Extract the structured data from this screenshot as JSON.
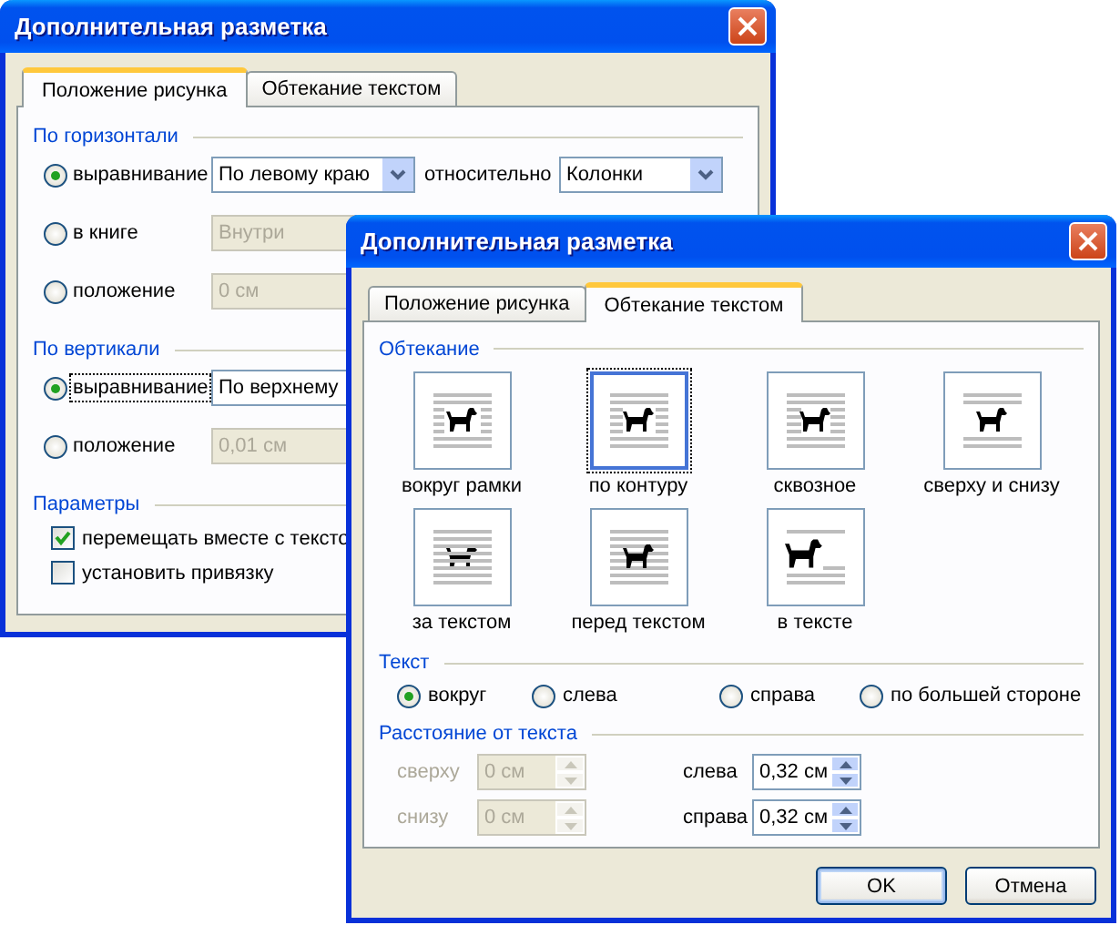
{
  "back_window": {
    "title": "Дополнительная разметка",
    "tabs": [
      {
        "label": "Положение рисунка",
        "selected": true
      },
      {
        "label": "Обтекание текстом",
        "selected": false
      }
    ],
    "sections": [
      {
        "title": "По горизонтали",
        "rows": [
          {
            "label": "выравнивание",
            "selected": true,
            "focused": false,
            "field": {
              "kind": "dropdown",
              "value": "По левому краю",
              "disabled": false
            },
            "relative_label": "относительно",
            "relative_field": {
              "kind": "dropdown",
              "value": "Колонки",
              "disabled": false
            }
          },
          {
            "label": "в книге",
            "selected": false,
            "focused": false,
            "field": {
              "kind": "dropdown",
              "value": "Внутри",
              "disabled": true
            }
          },
          {
            "label": "положение",
            "selected": false,
            "focused": false,
            "field": {
              "kind": "text",
              "value": "0 см",
              "disabled": true
            }
          }
        ]
      },
      {
        "title": "По вертикали",
        "rows": [
          {
            "label": "выравнивание",
            "selected": true,
            "focused": true,
            "field": {
              "kind": "dropdown",
              "value": "По верхнему",
              "disabled": false
            }
          },
          {
            "label": "положение",
            "selected": false,
            "focused": false,
            "field": {
              "kind": "text",
              "value": "0,01 см",
              "disabled": true
            }
          }
        ]
      }
    ],
    "options_title": "Параметры",
    "options": [
      {
        "label": "перемещать вместе с тексто",
        "checked": true
      },
      {
        "label": "установить привязку",
        "checked": false
      }
    ]
  },
  "front_window": {
    "title": "Дополнительная разметка",
    "tabs": [
      {
        "label": "Положение рисунка",
        "selected": false
      },
      {
        "label": "Обтекание текстом",
        "selected": true
      }
    ],
    "wrapping": {
      "title": "Обтекание",
      "items": [
        {
          "kind": "square",
          "label": "вокруг рамки",
          "selected": false
        },
        {
          "kind": "tight",
          "label": "по контуру",
          "selected": true
        },
        {
          "kind": "through",
          "label": "сквозное",
          "selected": false
        },
        {
          "kind": "top_bottom",
          "label": "сверху и снизу",
          "selected": false
        },
        {
          "kind": "behind",
          "label": "за текстом",
          "selected": false
        },
        {
          "kind": "in_front",
          "label": "перед текстом",
          "selected": false
        },
        {
          "kind": "inline",
          "label": "в тексте",
          "selected": false
        }
      ]
    },
    "text": {
      "title": "Текст",
      "options": [
        {
          "label": "вокруг",
          "selected": true
        },
        {
          "label": "слева",
          "selected": false
        },
        {
          "label": "справа",
          "selected": false
        },
        {
          "label": "по большей стороне",
          "selected": false
        }
      ]
    },
    "distance": {
      "title": "Расстояние от текста",
      "fields": [
        {
          "label": "сверху",
          "value": "0 см",
          "disabled": true
        },
        {
          "label": "слева",
          "value": "0,32 см",
          "disabled": false
        },
        {
          "label": "снизу",
          "value": "0 см",
          "disabled": true
        },
        {
          "label": "справа",
          "value": "0,32 см",
          "disabled": false
        }
      ]
    },
    "buttons": [
      {
        "label": "OK",
        "default": true
      },
      {
        "label": "Отмена",
        "default": false
      }
    ]
  }
}
